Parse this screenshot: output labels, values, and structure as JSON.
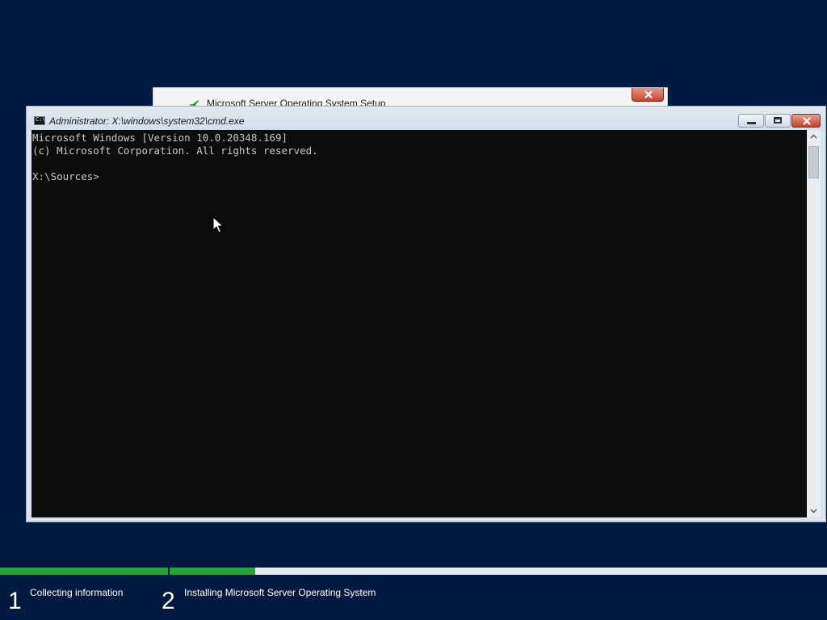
{
  "background_window": {
    "title": "Microsoft Server Operating System Setup"
  },
  "cmd_window": {
    "title": "Administrator: X:\\windows\\system32\\cmd.exe",
    "icon_text": "C:\\",
    "console_lines": [
      "Microsoft Windows [Version 10.0.20348.169]",
      "(c) Microsoft Corporation. All rights reserved.",
      "",
      "X:\\Sources>"
    ]
  },
  "progress": {
    "steps": [
      {
        "number": "1",
        "label": "Collecting information",
        "fill": 1.0
      },
      {
        "number": "2",
        "label": "Installing Microsoft Server Operating System",
        "fill": 0.13
      }
    ],
    "fill_color": "#1ea833",
    "track_color": "#e8eaed"
  },
  "colors": {
    "desktop_bg": "#031a40",
    "console_bg": "#0c0c0c",
    "console_fg": "#c8c8c8"
  }
}
